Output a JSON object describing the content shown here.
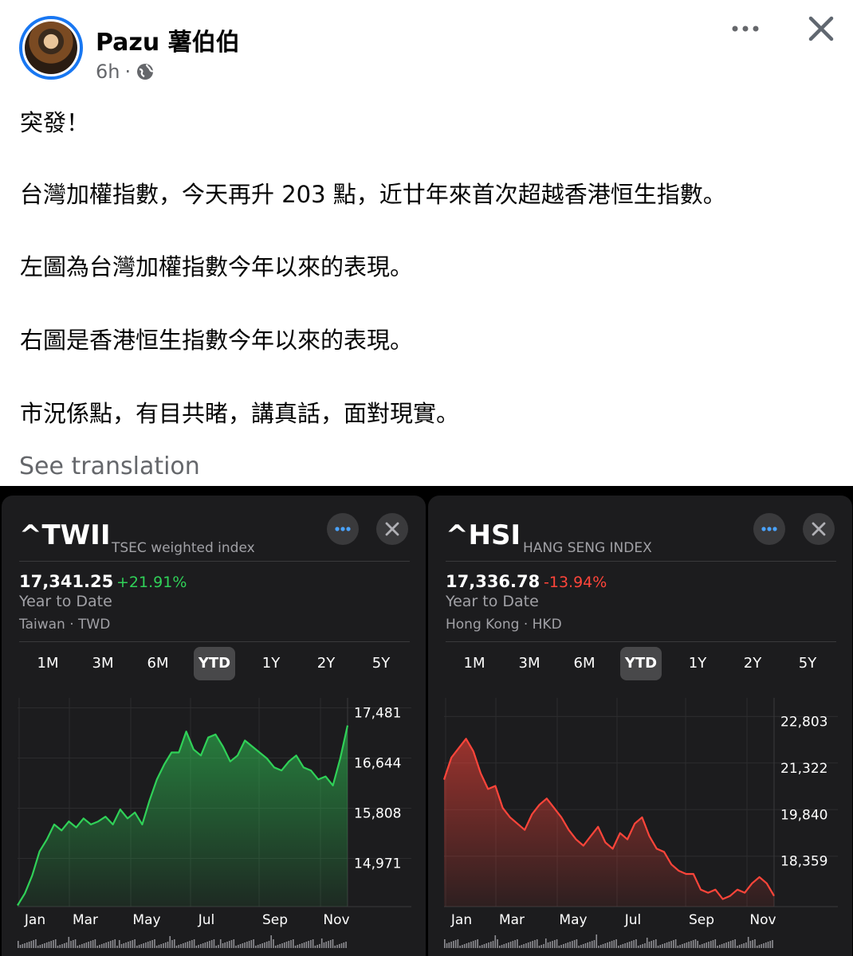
{
  "post": {
    "author": "Pazu 薯伯伯",
    "time": "6h",
    "meta_sep": "·",
    "icons": {
      "more": "more-dots-icon",
      "close": "close-icon",
      "audience": "globe-icon"
    },
    "paragraphs": [
      "突發！",
      "台灣加權指數，今天再升 203 點，近廿年來首次超越香港恒生指數。",
      "左圖為台灣加權指數今年以來的表現。",
      "右圖是香港恒生指數今年以來的表現。",
      "市況係點，有目共睹，講真話，面對現實。"
    ],
    "see_translation": "See translation"
  },
  "left_card": {
    "ticker": "^TWII",
    "name": "TSEC weighted index",
    "price": "17,341.25",
    "change": "+21.91%",
    "change_color": "#30d158",
    "period": "Year to Date",
    "region": "Taiwan · TWD",
    "tabs": [
      "1M",
      "3M",
      "6M",
      "YTD",
      "1Y",
      "2Y",
      "5Y"
    ],
    "active_tab": "YTD"
  },
  "right_card": {
    "ticker": "^HSI",
    "name": "HANG SENG INDEX",
    "price": "17,336.78",
    "change": "-13.94%",
    "change_color": "#ff453a",
    "period": "Year to Date",
    "region": "Hong Kong · HKD",
    "tabs": [
      "1M",
      "3M",
      "6M",
      "YTD",
      "1Y",
      "2Y",
      "5Y"
    ],
    "active_tab": "YTD"
  },
  "chart_data": [
    {
      "type": "area",
      "color": "#30d158",
      "x_ticks": [
        "Jan",
        "Mar",
        "May",
        "Jul",
        "Sep",
        "Nov"
      ],
      "y_ticks": [
        "17,481",
        "16,644",
        "15,808",
        "14,971"
      ],
      "y_tick_values": [
        17481,
        16644,
        15808,
        14971
      ],
      "ylim": [
        14380,
        17860
      ],
      "x": [
        1,
        2,
        3,
        4,
        5,
        6,
        7,
        8,
        9,
        10,
        11,
        12,
        13,
        14,
        15,
        16,
        17,
        18,
        19,
        20,
        21,
        22,
        23,
        24,
        25,
        26,
        27,
        28,
        29,
        30,
        31,
        32,
        33,
        34,
        35,
        36,
        37,
        38,
        39,
        40,
        41,
        42,
        43,
        44,
        45,
        46
      ],
      "values": [
        14400,
        14600,
        14900,
        15300,
        15500,
        15750,
        15650,
        15800,
        15700,
        15850,
        15750,
        15800,
        15880,
        15750,
        16000,
        15850,
        15950,
        15750,
        16150,
        16500,
        16750,
        16950,
        16950,
        17300,
        17000,
        16900,
        17200,
        17250,
        17050,
        16800,
        16900,
        17150,
        17050,
        16950,
        16850,
        16700,
        16650,
        16800,
        16900,
        16700,
        16650,
        16500,
        16550,
        16400,
        16850,
        17400
      ]
    },
    {
      "type": "area",
      "color": "#ff453a",
      "x_ticks": [
        "Jan",
        "Mar",
        "May",
        "Jul",
        "Sep",
        "Nov"
      ],
      "y_ticks": [
        "22,803",
        "21,322",
        "19,840",
        "18,359"
      ],
      "y_tick_values": [
        22803,
        21322,
        19840,
        18359
      ],
      "ylim": [
        17160,
        23800
      ],
      "x": [
        1,
        2,
        3,
        4,
        5,
        6,
        7,
        8,
        9,
        10,
        11,
        12,
        13,
        14,
        15,
        16,
        17,
        18,
        19,
        20,
        21,
        22,
        23,
        24,
        25,
        26,
        27,
        28,
        29,
        30,
        31,
        32,
        33,
        34,
        35,
        36,
        37,
        38,
        39,
        40,
        41,
        42,
        43,
        44,
        45,
        46
      ],
      "values": [
        21200,
        21900,
        22200,
        22500,
        22100,
        21400,
        20900,
        21000,
        20300,
        20000,
        19800,
        19600,
        20100,
        20400,
        20600,
        20300,
        20000,
        19600,
        19300,
        19100,
        19400,
        19700,
        19200,
        19000,
        19500,
        19300,
        19800,
        20000,
        19400,
        19000,
        18900,
        18500,
        18300,
        18200,
        18200,
        17700,
        17600,
        17700,
        17400,
        17500,
        17700,
        17600,
        17900,
        18100,
        17900,
        17500
      ]
    }
  ]
}
